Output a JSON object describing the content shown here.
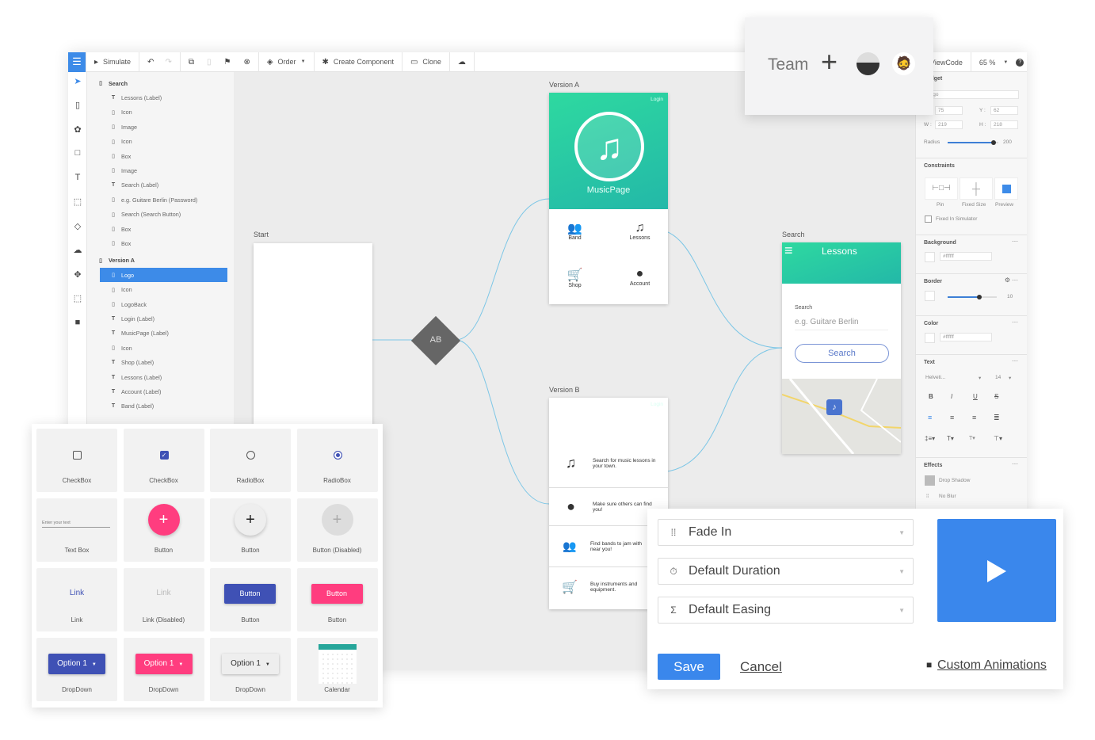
{
  "toolbar": {
    "simulate": "Simulate",
    "order": "Order",
    "create_component": "Create Component",
    "clone": "Clone",
    "viewcode": "ViewCode",
    "zoom": "65 %"
  },
  "tree": {
    "items": [
      {
        "label": "Search",
        "icon": "box",
        "group": true
      },
      {
        "label": "Lessons (Label)",
        "icon": "T"
      },
      {
        "label": "Icon",
        "icon": "box"
      },
      {
        "label": "Image",
        "icon": "box"
      },
      {
        "label": "Icon",
        "icon": "box"
      },
      {
        "label": "Box",
        "icon": "box"
      },
      {
        "label": "Image",
        "icon": "box"
      },
      {
        "label": "Search (Label)",
        "icon": "T"
      },
      {
        "label": "e.g. Guitare Berlin (Password)",
        "icon": "box"
      },
      {
        "label": "Search (Search Button)",
        "icon": "box"
      },
      {
        "label": "Box",
        "icon": "box"
      },
      {
        "label": "Box",
        "icon": "box"
      },
      {
        "label": "Version A",
        "icon": "box",
        "group": true
      },
      {
        "label": "Logo",
        "icon": "box",
        "selected": true
      },
      {
        "label": "Icon",
        "icon": "box"
      },
      {
        "label": "LogoBack",
        "icon": "box"
      },
      {
        "label": "Login (Label)",
        "icon": "T"
      },
      {
        "label": "MusicPage (Label)",
        "icon": "T"
      },
      {
        "label": "Icon",
        "icon": "box"
      },
      {
        "label": "Shop (Label)",
        "icon": "T"
      },
      {
        "label": "Lessons (Label)",
        "icon": "T"
      },
      {
        "label": "Account (Label)",
        "icon": "T"
      },
      {
        "label": "Band (Label)",
        "icon": "T"
      }
    ]
  },
  "props": {
    "widget_title": "Widget",
    "name": "Logo",
    "x_label": "X :",
    "x": "75",
    "y_label": "Y :",
    "y": "62",
    "w_label": "W :",
    "w": "219",
    "h_label": "H :",
    "h": "218",
    "radius_label": "Radius",
    "radius": "200",
    "radius_fraction": 0.9,
    "constraints": "Constraints",
    "pin": "Pin",
    "fixed_size": "Fixed Size",
    "preview": "Preview",
    "fixed_sim": "Fixed In Simulator",
    "background": "Background",
    "bg_value": "#ffffff",
    "border": "Border",
    "border_value": "10",
    "border_fraction": 0.65,
    "color": "Color",
    "color_value": "#ffffff",
    "text": "Text",
    "font": "Helveti...",
    "font_size": "14",
    "effects": "Effects",
    "drop_shadow": "Drop Shadow",
    "no_blur": "No Blur"
  },
  "canvas": {
    "start_label": "Start",
    "version_a_label": "Version A",
    "version_b_label": "Version B",
    "search_label": "Search",
    "ab": "AB",
    "app_name": "MusicPage",
    "login": "Login",
    "grid": [
      "Band",
      "Lessons",
      "Shop",
      "Account"
    ],
    "version_b_items": [
      "Search for music lessons in your town.",
      "Make sure others can find you!",
      "Find bands to jam with near you!",
      "Buy instruments and equipment."
    ],
    "search_screen": {
      "title": "Lessons",
      "field_label": "Search",
      "placeholder": "e.g. Guitare Berlin",
      "button": "Search"
    }
  },
  "team": {
    "label": "Team"
  },
  "widgets": [
    {
      "caption": "CheckBox",
      "kind": "checkbox"
    },
    {
      "caption": "CheckBox",
      "kind": "checkbox-checked"
    },
    {
      "caption": "RadioBox",
      "kind": "radio"
    },
    {
      "caption": "RadioBox",
      "kind": "radio-checked"
    },
    {
      "caption": "Text Box",
      "kind": "textbox",
      "placeholder": "Enter your text"
    },
    {
      "caption": "Button",
      "kind": "fab-pink"
    },
    {
      "caption": "Button",
      "kind": "fab-light"
    },
    {
      "caption": "Button (Disabled)",
      "kind": "fab-disabled"
    },
    {
      "caption": "Link",
      "kind": "link",
      "text": "Link"
    },
    {
      "caption": "Link (Disabled)",
      "kind": "link-disabled",
      "text": "Link"
    },
    {
      "caption": "Button",
      "kind": "btn-indigo",
      "text": "Button"
    },
    {
      "caption": "Button",
      "kind": "btn-pink",
      "text": "Button"
    },
    {
      "caption": "DropDown",
      "kind": "dd-indigo",
      "text": "Option 1"
    },
    {
      "caption": "DropDown",
      "kind": "dd-pink",
      "text": "Option 1"
    },
    {
      "caption": "DropDown",
      "kind": "dd-light",
      "text": "Option 1"
    },
    {
      "caption": "Calendar",
      "kind": "calendar"
    }
  ],
  "animation": {
    "effect": "Fade In",
    "duration": "Default Duration",
    "easing": "Default Easing",
    "save": "Save",
    "cancel": "Cancel",
    "custom": "Custom Animations"
  },
  "colors": {
    "accent": "#3d8be8",
    "indigo": "#3f51b5",
    "pink": "#ff3d7f",
    "teal": "#2ccfa4",
    "connector": "#7cc6e6"
  }
}
